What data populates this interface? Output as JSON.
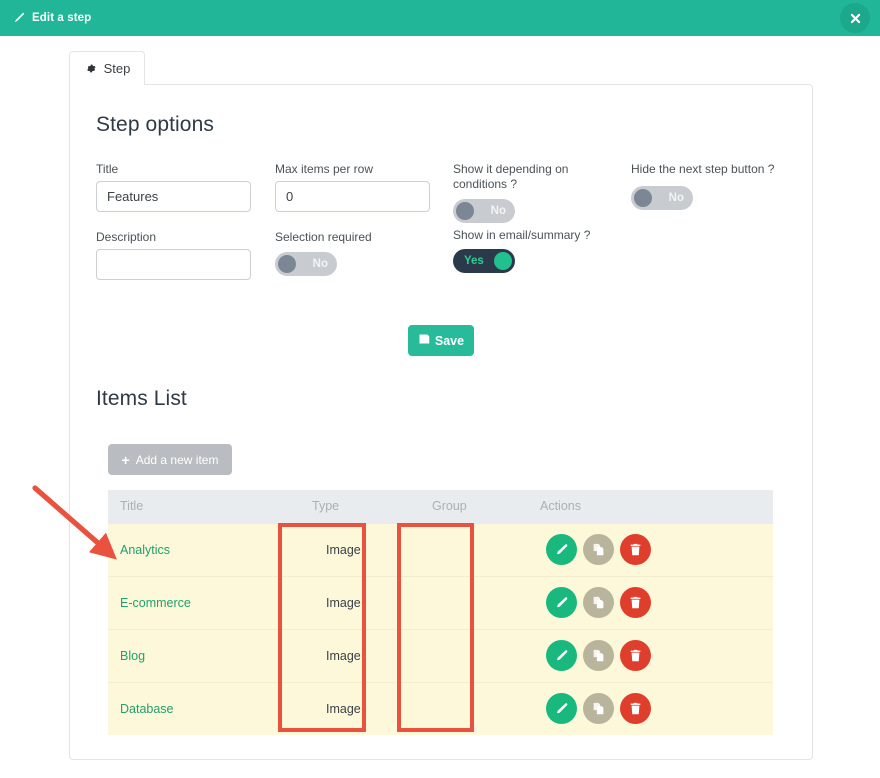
{
  "topbar": {
    "title": "Edit a step",
    "pencil_icon": "pencil-icon",
    "close_icon": "close-icon",
    "bg_color": "#21b698"
  },
  "tab": {
    "label": "Step",
    "icon": "gear-icon"
  },
  "step_options": {
    "heading": "Step options",
    "fields": {
      "title": {
        "label": "Title",
        "value": "Features",
        "placeholder": ""
      },
      "description": {
        "label": "Description",
        "value": "",
        "placeholder": ""
      },
      "max_items_per_row": {
        "label": "Max items per row",
        "value": "0",
        "placeholder": ""
      },
      "selection_required": {
        "label": "Selection required",
        "value": "No",
        "state": "off"
      },
      "show_it_depending_on_conditions": {
        "label": "Show it depending on conditions ?",
        "value": "No",
        "state": "off"
      },
      "show_in_email_summary": {
        "label": "Show in email/summary ?",
        "value": "Yes",
        "state": "on"
      },
      "hide_the_next_step_button": {
        "label": "Hide the next step button ?",
        "value": "No",
        "state": "off"
      }
    },
    "save_label": "Save",
    "save_icon": "floppy-disk-icon"
  },
  "items_list": {
    "heading": "Items List",
    "add_button": {
      "label": "Add a new item",
      "icon": "plus-icon"
    },
    "columns": [
      "Title",
      "Type",
      "Group",
      "Actions"
    ],
    "rows": [
      {
        "title": "Analytics",
        "type": "Image",
        "group": ""
      },
      {
        "title": "E-commerce",
        "type": "Image",
        "group": ""
      },
      {
        "title": "Blog",
        "type": "Image",
        "group": ""
      },
      {
        "title": "Database",
        "type": "Image",
        "group": ""
      }
    ],
    "row_actions": [
      {
        "name": "edit",
        "icon": "pencil-icon",
        "color": "#19b87e"
      },
      {
        "name": "duplicate",
        "icon": "copy-icon",
        "color": "#b9b49c"
      },
      {
        "name": "delete",
        "icon": "trash-icon",
        "color": "#e03e2d"
      }
    ]
  },
  "annotations": {
    "color": "#e8523f",
    "boxes": [
      "type-column-highlight",
      "group-column-highlight"
    ],
    "arrow": "arrow-pointing-to-first-row"
  },
  "colors": {
    "accent_green": "#21b698",
    "save_green": "#28bb9a",
    "row_yellow": "#fcf8d9",
    "header_gray": "#e8ecee",
    "link_green": "#21a06d",
    "toggle_on_track": "#2b3a4a",
    "toggle_off_track": "#c8ccd0"
  }
}
